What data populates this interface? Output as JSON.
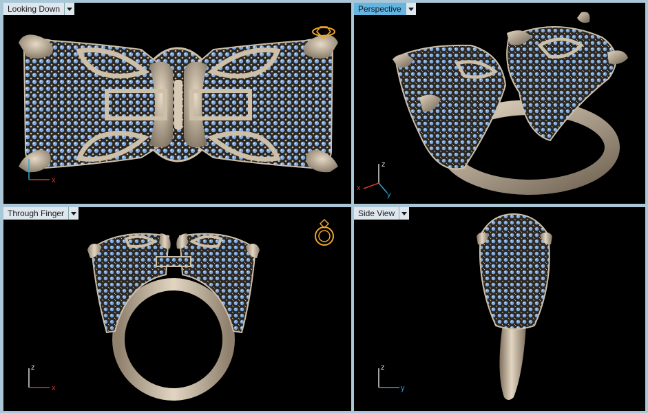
{
  "viewports": [
    {
      "title": "Looking Down",
      "active": false,
      "axes": [
        "x"
      ]
    },
    {
      "title": "Perspective",
      "active": true,
      "axes": [
        "z",
        "x",
        "y"
      ]
    },
    {
      "title": "Through Finger",
      "active": false,
      "axes": [
        "z",
        "x"
      ]
    },
    {
      "title": "Side View",
      "active": false,
      "axes": [
        "z",
        "y"
      ]
    }
  ],
  "colors": {
    "metal": "#c9baa4",
    "metal_dark": "#8e806c",
    "stone": "#7fa8de",
    "stone_light": "#b6d1f2",
    "background": "#000000",
    "gizmo": "#f2a628",
    "axis_x": "#d23a2e",
    "axis_y": "#2fa6d8",
    "axis_z": "#d8d8d8"
  },
  "icons": {
    "top_gizmo": "diamond-ring-top-icon",
    "front_gizmo": "ring-front-icon"
  }
}
